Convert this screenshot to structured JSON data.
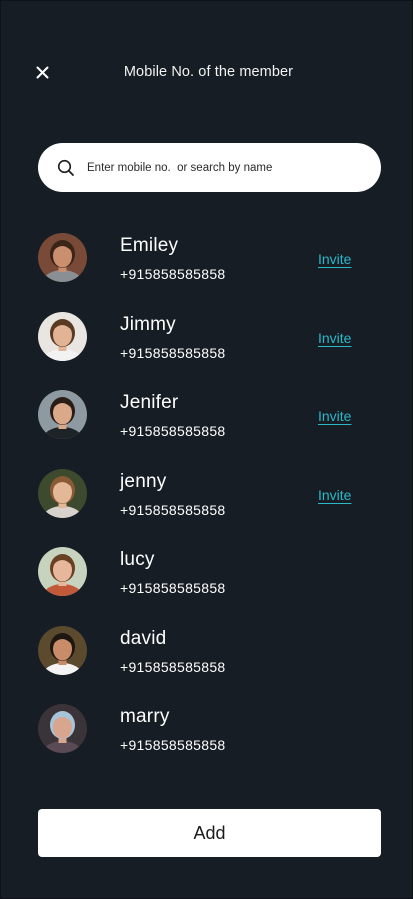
{
  "header": {
    "title": "Mobile No. of the member",
    "close_icon": "close-icon"
  },
  "search": {
    "placeholder": "Enter mobile no.  or search by name",
    "value": "",
    "icon": "search-icon"
  },
  "contacts": [
    {
      "name": "Emiley",
      "phone": "+915858585858",
      "invite_label": "Invite",
      "avatar_bg": "#7a4a38",
      "avatar_hair": "#3b2418",
      "avatar_skin": "#c98f6f",
      "avatar_shirt": "#8a8f94"
    },
    {
      "name": "Jimmy",
      "phone": "+915858585858",
      "invite_label": "Invite",
      "avatar_bg": "#e9e6e2",
      "avatar_hair": "#5a3a22",
      "avatar_skin": "#e3b395",
      "avatar_shirt": "#f2f2f2"
    },
    {
      "name": "Jenifer",
      "phone": "+915858585858",
      "invite_label": "Invite",
      "avatar_bg": "#8e9aa1",
      "avatar_hair": "#2a1d16",
      "avatar_skin": "#d9a98a",
      "avatar_shirt": "#1e2328"
    },
    {
      "name": "jenny",
      "phone": "+915858585858",
      "invite_label": "Invite",
      "avatar_bg": "#3e4a2e",
      "avatar_hair": "#8a5a34",
      "avatar_skin": "#e2b896",
      "avatar_shirt": "#d7d2cc"
    },
    {
      "name": "lucy",
      "phone": "+915858585858",
      "invite_label": "",
      "avatar_bg": "#c7d3bf",
      "avatar_hair": "#6a4024",
      "avatar_skin": "#e6b79b",
      "avatar_shirt": "#c25a3a"
    },
    {
      "name": "david",
      "phone": "+915858585858",
      "invite_label": "",
      "avatar_bg": "#5b4a2e",
      "avatar_hair": "#1e1612",
      "avatar_skin": "#c88d68",
      "avatar_shirt": "#f4f4f4"
    },
    {
      "name": "marry",
      "phone": "+915858585858",
      "invite_label": "",
      "avatar_bg": "#3a3338",
      "avatar_hair": "#a7c4d8",
      "avatar_skin": "#d8a58e",
      "avatar_shirt": "#5a4a55"
    }
  ],
  "footer": {
    "add_label": "Add"
  },
  "colors": {
    "background": "#161d24",
    "accent": "#2bb8c9",
    "text": "#ffffff",
    "button_bg": "#ffffff"
  }
}
